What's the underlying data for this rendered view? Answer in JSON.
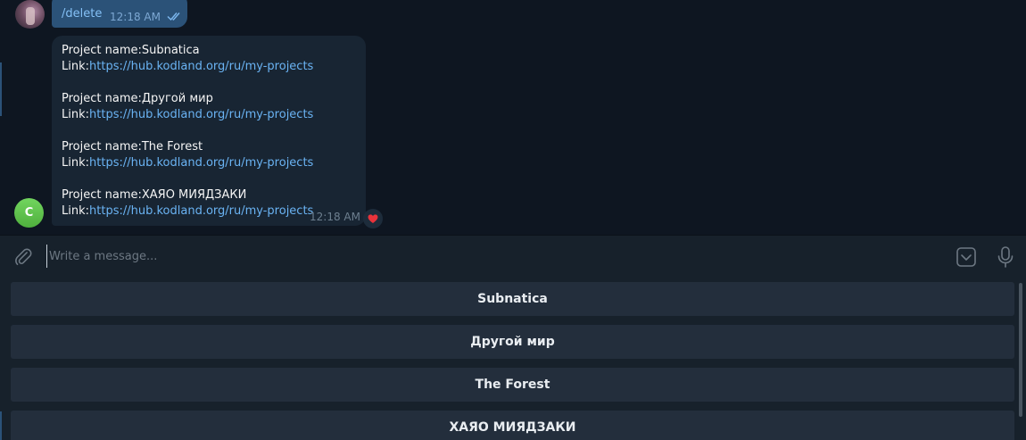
{
  "outgoing_message": {
    "text": "/delete",
    "time": "12:18 AM",
    "status": "read"
  },
  "incoming_message": {
    "time": "12:18 AM",
    "reaction": "heart",
    "sender_initial": "C",
    "projects": [
      {
        "name_line": "Project name:Subnatica",
        "link_label": "Link:",
        "link": "https://hub.kodland.org/ru/my-projects"
      },
      {
        "name_line": "Project name:Другой мир",
        "link_label": "Link:",
        "link": "https://hub.kodland.org/ru/my-projects"
      },
      {
        "name_line": "Project name:The Forest",
        "link_label": "Link:",
        "link": "https://hub.kodland.org/ru/my-projects"
      },
      {
        "name_line": "Project name:ХАЯО МИЯДЗАКИ",
        "link_label": "Link:",
        "link": "https://hub.kodland.org/ru/my-projects"
      }
    ]
  },
  "composer": {
    "placeholder": "Write a message..."
  },
  "keyboard_buttons": [
    {
      "label": "Subnatica"
    },
    {
      "label": "Другой мир"
    },
    {
      "label": "The Forest"
    },
    {
      "label": "ХАЯО МИЯДЗАКИ"
    }
  ],
  "colors": {
    "background": "#0e1621",
    "outgoing_bubble": "#2b5278",
    "incoming_bubble": "#182533",
    "link": "#6ab3f3",
    "keyboard_button": "#232e3c"
  },
  "icons": {
    "attach": "paperclip-icon",
    "keyboard": "keyboard-toggle-icon",
    "voice": "microphone-icon",
    "read_status": "double-check-icon",
    "reaction": "heart-icon"
  }
}
